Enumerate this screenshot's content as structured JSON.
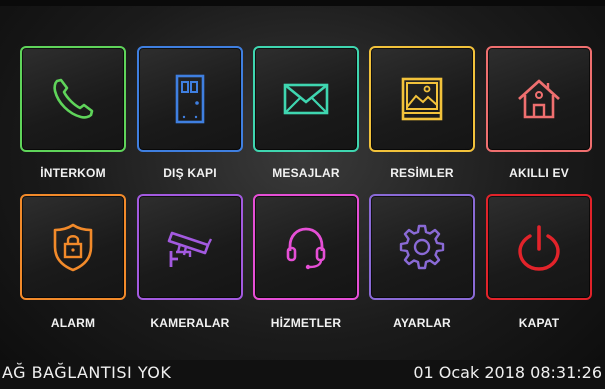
{
  "tiles": [
    {
      "label": "İNTERKOM",
      "icon": "phone-icon",
      "color": "#5fd45a"
    },
    {
      "label": "DIŞ KAPI",
      "icon": "door-icon",
      "color": "#3f7fe0"
    },
    {
      "label": "MESAJLAR",
      "icon": "envelope-icon",
      "color": "#3fd6b0"
    },
    {
      "label": "RESİMLER",
      "icon": "image-icon",
      "color": "#f2c23b"
    },
    {
      "label": "AKILLI EV",
      "icon": "smart-home-icon",
      "color": "#ef6f6f"
    },
    {
      "label": "ALARM",
      "icon": "shield-lock-icon",
      "color": "#f28a2a"
    },
    {
      "label": "KAMERALAR",
      "icon": "security-camera-icon",
      "color": "#a35ae0"
    },
    {
      "label": "HİZMETLER",
      "icon": "headset-icon",
      "color": "#e64fd6"
    },
    {
      "label": "AYARLAR",
      "icon": "gear-icon",
      "color": "#8a6ad6"
    },
    {
      "label": "KAPAT",
      "icon": "power-icon",
      "color": "#e2232a"
    }
  ],
  "status": {
    "connection": "AĞ BAĞLANTISI YOK",
    "datetime": "01 Ocak 2018 08:31:26"
  }
}
